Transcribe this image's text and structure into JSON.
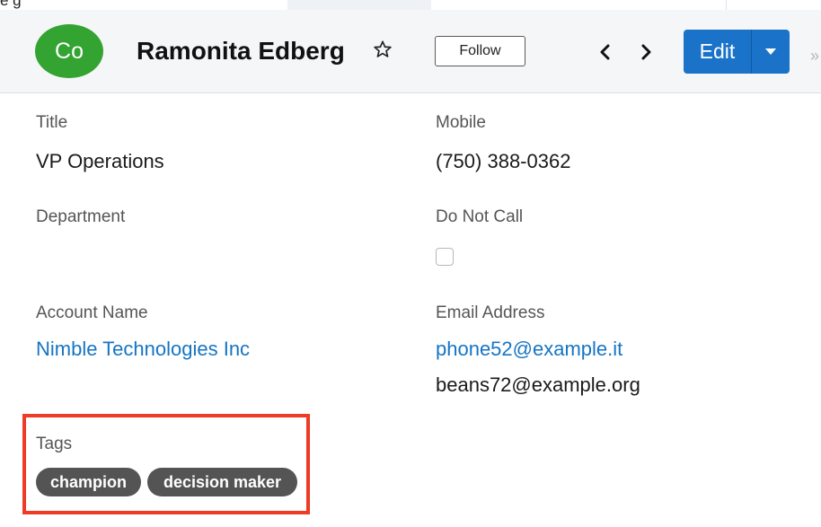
{
  "top_strip": {
    "clipped_text": "e g"
  },
  "record": {
    "avatar_initials": "Co",
    "name": "Ramonita Edberg",
    "follow_label": "Follow",
    "edit_label": "Edit"
  },
  "icons": {
    "favorite": "star-outline-icon",
    "previous": "chevron-left-icon",
    "next": "chevron-right-icon",
    "actions": "caret-down-icon",
    "collapse": "double-chevron-right-icon"
  },
  "fields": {
    "title": {
      "label": "Title",
      "value": "VP Operations"
    },
    "mobile": {
      "label": "Mobile",
      "value": "(750) 388-0362"
    },
    "department": {
      "label": "Department",
      "value": ""
    },
    "do_not_call": {
      "label": "Do Not Call",
      "checked": false
    },
    "account_name": {
      "label": "Account Name",
      "value": "Nimble Technologies Inc"
    },
    "email": {
      "label": "Email Address",
      "primary": "phone52@example.it",
      "secondary": "beans72@example.org"
    },
    "tags": {
      "label": "Tags",
      "items": [
        "champion",
        "decision maker"
      ]
    }
  },
  "colors": {
    "avatar": "#33a331",
    "primary_button": "#1a73c9",
    "link": "#1575c4",
    "tag_bg": "#545454",
    "highlight": "#ee3b25",
    "header_bg": "#f5f6f8"
  }
}
